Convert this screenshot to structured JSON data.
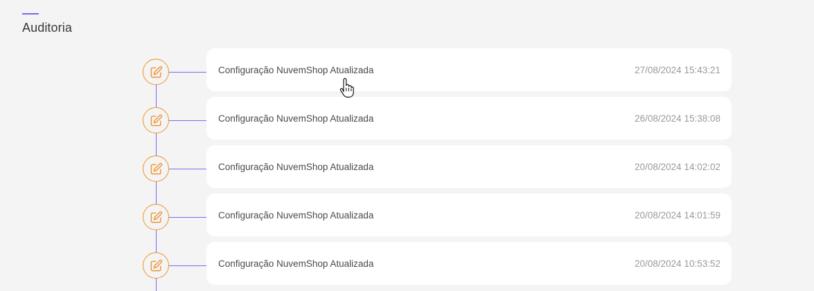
{
  "page": {
    "title": "Auditoria"
  },
  "colors": {
    "accent": "#7b68ee",
    "node": "#f0932b",
    "background": "#f4f4f4",
    "card": "#ffffff"
  },
  "timeline": {
    "node_icon": "edit-pencil-icon",
    "entries": [
      {
        "title": "Configuração NuvemShop Atualizada",
        "date": "27/08/2024 15:43:21"
      },
      {
        "title": "Configuração NuvemShop Atualizada",
        "date": "26/08/2024 15:38:08"
      },
      {
        "title": "Configuração NuvemShop Atualizada",
        "date": "20/08/2024 14:02:02"
      },
      {
        "title": "Configuração NuvemShop Atualizada",
        "date": "20/08/2024 14:01:59"
      },
      {
        "title": "Configuração NuvemShop Atualizada",
        "date": "20/08/2024 10:53:52"
      }
    ]
  }
}
